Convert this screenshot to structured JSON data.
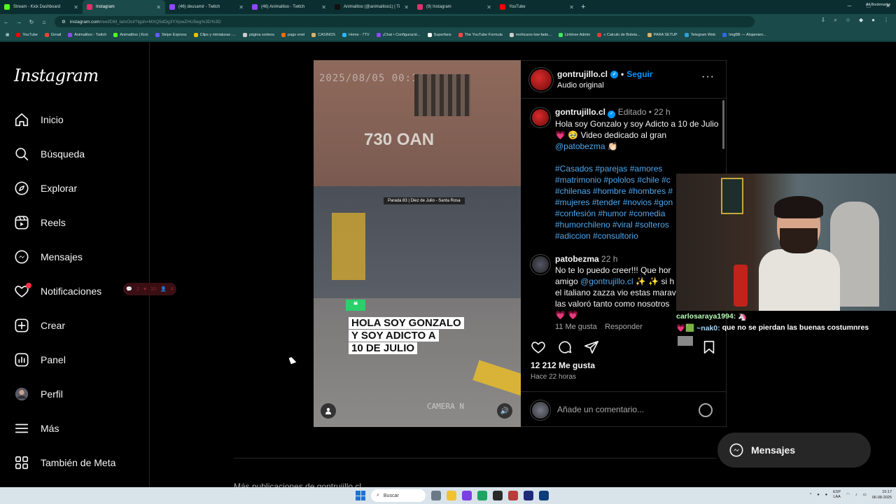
{
  "browser": {
    "tabs": [
      {
        "label": "Stream - Kick Dashboard",
        "color": "#53fc18",
        "active": false
      },
      {
        "label": "Instagram",
        "color": "#e1306c",
        "active": true
      },
      {
        "label": "(46) deusamir - Twitch",
        "color": "#9146ff",
        "active": false
      },
      {
        "label": "(46) Animalitoo - Twitch",
        "color": "#9146ff",
        "active": false
      },
      {
        "label": "Animalitoo (@animalitoo1) | Ti",
        "color": "#111111",
        "active": false
      },
      {
        "label": "(9) Instagram",
        "color": "#e1306c",
        "active": false
      },
      {
        "label": "YouTube",
        "color": "#ff0000",
        "active": false
      }
    ],
    "url_host": "instagram.com",
    "url_path": "/reel/DM_taIvOsI/?igsh=MXQ5dDg3YXpwZHU5eg%3D%3D",
    "bookmarks": [
      {
        "label": "YouTube",
        "color": "#ff0000"
      },
      {
        "label": "Gmail",
        "color": "#ea4335"
      },
      {
        "label": "Animalitoo - Twitch",
        "color": "#9146ff"
      },
      {
        "label": "Animalitoo | Kick",
        "color": "#53fc18"
      },
      {
        "label": "Stripe Express",
        "color": "#635bff"
      },
      {
        "label": "Clips y miniaturas -...",
        "color": "#e6c200"
      },
      {
        "label": "página sorteos",
        "color": "#cccccc"
      },
      {
        "label": "pago enel",
        "color": "#ff6a00"
      },
      {
        "label": "CASINOS",
        "color": "#d9b26a"
      },
      {
        "label": "Home - 7TV",
        "color": "#29b6f6"
      },
      {
        "label": "¡Chat • Configuració...",
        "color": "#9146ff"
      },
      {
        "label": "Superfans",
        "color": "#ffffff"
      },
      {
        "label": "The YouTube Formula",
        "color": "#ff4444"
      },
      {
        "label": "mohicano-low-fade...",
        "color": "#cccccc"
      },
      {
        "label": "Linktree Admin",
        "color": "#43e660"
      },
      {
        "label": "« Calculo de Boleta...",
        "color": "#e53935"
      },
      {
        "label": "PARA SETUP",
        "color": "#d9b26a"
      },
      {
        "label": "Telegram Web",
        "color": "#2aa1da"
      },
      {
        "label": "ImgBB — Alojamien...",
        "color": "#2a6be0"
      }
    ],
    "all_bookmarks": "All Bookmarks"
  },
  "sidebar": {
    "logo": "Instagram",
    "items": [
      {
        "label": "Inicio",
        "icon": "home-icon"
      },
      {
        "label": "Búsqueda",
        "icon": "search-icon"
      },
      {
        "label": "Explorar",
        "icon": "compass-icon"
      },
      {
        "label": "Reels",
        "icon": "reels-icon"
      },
      {
        "label": "Mensajes",
        "icon": "messenger-icon"
      },
      {
        "label": "Notificaciones",
        "icon": "heart-icon"
      },
      {
        "label": "Crear",
        "icon": "plus-square-icon"
      },
      {
        "label": "Panel",
        "icon": "chart-icon"
      },
      {
        "label": "Perfil",
        "icon": "avatar"
      },
      {
        "label": "Más",
        "icon": "menu-icon"
      },
      {
        "label": "También de Meta",
        "icon": "grid-icon"
      }
    ],
    "notif_pill": {
      "comments": "2",
      "likes": "10",
      "follows": "4"
    }
  },
  "video": {
    "stamp": "2025/08/05  00:14",
    "graffiti": "730 OAN",
    "sign": "Parada  83  |  Diez de Julio - Santa Rosa",
    "quote_icon": "❝",
    "caption_lines": [
      "HOLA SOY GONZALO",
      "Y SOY ADICTO A",
      "10 DE JULIO"
    ],
    "watermark": "CAMERA N",
    "sound_icon": "🔊"
  },
  "post": {
    "username": "gontrujillo.cl",
    "follow": "Seguir",
    "audio": "Audio original",
    "caption": {
      "username": "gontrujillo.cl",
      "edited": "Editado",
      "time": "22 h",
      "text1": "Hola soy Gonzalo y soy Adicto a 10 de Julio 💗 🥹 Video dedicado al gran",
      "mention": "@patobezma",
      "mention_emoji": "👏🏻",
      "hashtags": [
        "#Casados #parejas #amores",
        "#matrimonio #pololos #chile #c",
        "#chilenas #hombre #hombres #",
        "#mujeres #tender #novios #gon",
        "#confesión #humor #comedia",
        "#humorchileno #viral #solteros",
        "#adiccion #consultorio"
      ]
    },
    "comment": {
      "username": "patobezma",
      "time": "22 h",
      "line1": "No te lo puedo creer!!! Que hor",
      "line2_pre": "amigo ",
      "line2_mention": "@gontrujillo.cl",
      "line2_post": " ✨ ✨ si h",
      "line3": "el italiano zazza vio estas marav",
      "line4": "las valoró tanto como nosotros",
      "line5": "💗 💗",
      "likes": "11 Me gusta",
      "reply": "Responder"
    },
    "likes": "12 212 Me gusta",
    "ago": "Hace 22 horas",
    "comment_placeholder": "Añade un comentario..."
  },
  "overlay_chat": [
    {
      "user": "carlosaraya1994:",
      "msg": " 🦄",
      "color": "#b6ffb6"
    },
    {
      "user": "💗🟩 ~nak0:",
      "msg": " que no se pierdan las buenas costumnres",
      "color": "#9fd6ff"
    }
  ],
  "messages_fab": "Mensajes",
  "more_from": "Más publicaciones de gontrujillo.cl",
  "taskbar": {
    "search": "Buscar",
    "lang1": "ESP",
    "lang2": "LAA",
    "time": "15:17",
    "date": "06-08-2025"
  }
}
